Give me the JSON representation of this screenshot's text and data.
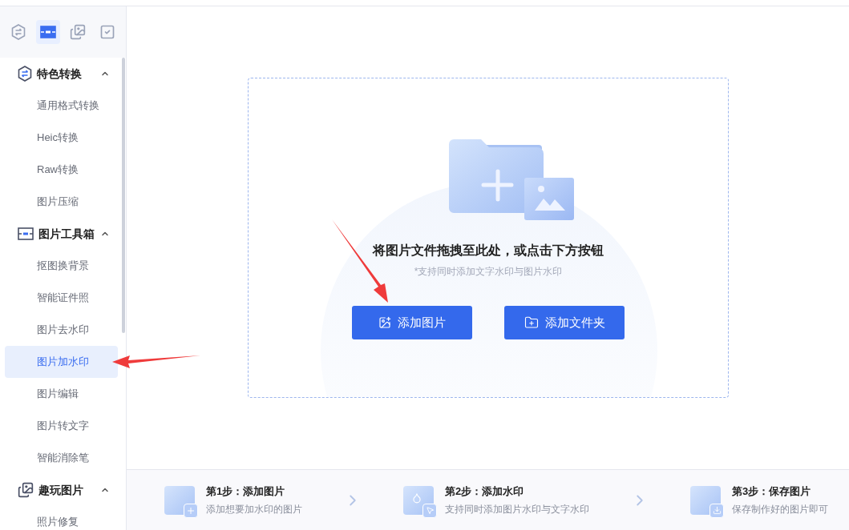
{
  "tool_tabs": [
    {
      "kind": "convert",
      "selected": false
    },
    {
      "kind": "toolbox",
      "selected": true
    },
    {
      "kind": "fun",
      "selected": false
    },
    {
      "kind": "batch",
      "selected": false
    }
  ],
  "sidebar": {
    "groups": [
      {
        "kind": "convert",
        "label": "特色转换",
        "expanded": true,
        "items": [
          {
            "label": "通用格式转换",
            "selected": false
          },
          {
            "label": "Heic转换",
            "selected": false
          },
          {
            "label": "Raw转换",
            "selected": false
          },
          {
            "label": "图片压缩",
            "selected": false
          }
        ]
      },
      {
        "kind": "toolbox",
        "label": "图片工具箱",
        "expanded": true,
        "items": [
          {
            "label": "抠图换背景",
            "selected": false
          },
          {
            "label": "智能证件照",
            "selected": false
          },
          {
            "label": "图片去水印",
            "selected": false
          },
          {
            "label": "图片加水印",
            "selected": true
          },
          {
            "label": "图片编辑",
            "selected": false
          },
          {
            "label": "图片转文字",
            "selected": false
          },
          {
            "label": "智能消除笔",
            "selected": false
          }
        ]
      },
      {
        "kind": "fun",
        "label": "趣玩图片",
        "expanded": true,
        "items": [
          {
            "label": "照片修复",
            "selected": false
          }
        ]
      }
    ]
  },
  "dropzone": {
    "title": "将图片文件拖拽至此处，或点击下方按钮",
    "hint": "*支持同时添加文字水印与图片水印",
    "buttons": [
      {
        "kind": "image",
        "label": "添加图片"
      },
      {
        "kind": "folder",
        "label": "添加文件夹"
      }
    ]
  },
  "steps": [
    {
      "kind": "add",
      "title": "第1步：添加图片",
      "desc": "添加想要加水印的图片"
    },
    {
      "kind": "mark",
      "title": "第2步：添加水印",
      "desc": "支持同时添加图片水印与文字水印"
    },
    {
      "kind": "save",
      "title": "第3步：保存图片",
      "desc": "保存制作好的图片即可"
    }
  ]
}
